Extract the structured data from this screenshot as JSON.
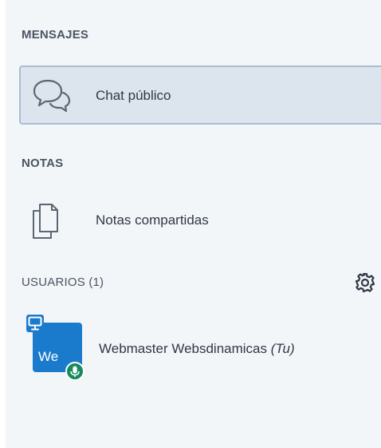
{
  "sections": {
    "messages_title": "MENSAJES",
    "notes_title": "NOTAS",
    "users_title": "USUARIOS (1)"
  },
  "chat": {
    "label": "Chat público",
    "icon": "chat-bubbles-icon"
  },
  "notes": {
    "label": "Notas compartidas",
    "icon": "documents-icon"
  },
  "users": {
    "settings_icon": "gear-icon",
    "list": [
      {
        "avatar_initials": "We",
        "name": "Webmaster Websdinamicas",
        "you_label": "(Tu)",
        "avatar_color": "#1a7bcd",
        "presenter_icon": "presenter-icon",
        "mic_icon": "microphone-icon"
      }
    ]
  },
  "colors": {
    "panel_bg": "#f3f6f9",
    "selected_bg": "#dce4ed",
    "selected_border": "#a9bdd3",
    "text": "#303845",
    "mic_green": "#178a5d"
  }
}
